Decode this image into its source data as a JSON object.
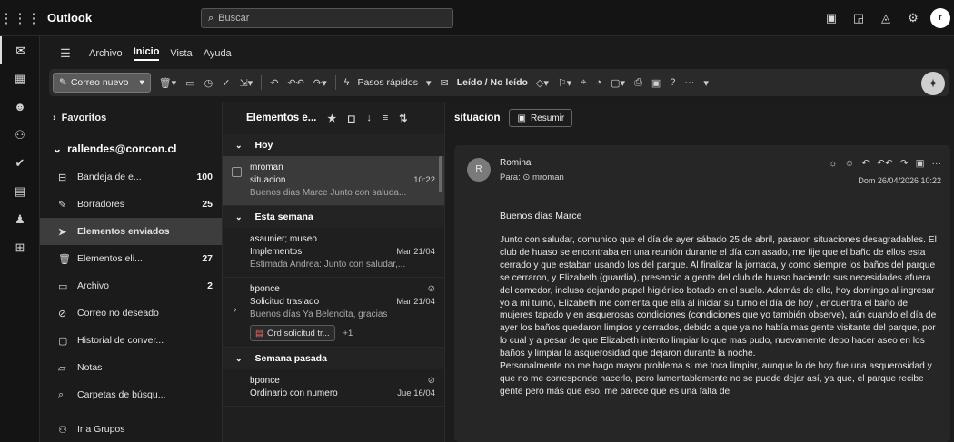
{
  "app": {
    "title": "Outlook",
    "search_placeholder": "Buscar"
  },
  "topbar_icons": [
    "present-icon",
    "feedback-icon",
    "bell-icon",
    "settings-icon"
  ],
  "rail_icons": [
    "mail-icon",
    "calendar-icon",
    "people-icon",
    "groups-icon",
    "todo-icon",
    "onedrive-icon",
    "org-icon",
    "apps-icon"
  ],
  "ribbon": {
    "tabs": [
      "Archivo",
      "Inicio",
      "Vista",
      "Ayuda"
    ],
    "active_tab": "Inicio",
    "new_mail": "Correo nuevo",
    "quick_steps": "Pasos rápidos",
    "read_unread": "Leído / No leído"
  },
  "folders": {
    "favorites": "Favoritos",
    "account": "rallendes@concon.cl",
    "items": [
      {
        "label": "Bandeja de e...",
        "count": "100",
        "icon": "inbox-icon"
      },
      {
        "label": "Borradores",
        "count": "25",
        "icon": "drafts-icon"
      },
      {
        "label": "Elementos enviados",
        "count": "",
        "icon": "sent-icon"
      },
      {
        "label": "Elementos eli...",
        "count": "27",
        "icon": "trash-icon"
      },
      {
        "label": "Archivo",
        "count": "2",
        "icon": "archive-icon"
      },
      {
        "label": "Correo no deseado",
        "count": "",
        "icon": "junk-icon"
      },
      {
        "label": "Historial de conver...",
        "count": "",
        "icon": "history-icon"
      },
      {
        "label": "Notas",
        "count": "",
        "icon": "notes-icon"
      },
      {
        "label": "Carpetas de búsqu...",
        "count": "",
        "icon": "search-folder-icon"
      }
    ],
    "groups": "Ir a Grupos"
  },
  "list": {
    "title": "Elementos e...",
    "groups": {
      "today": "Hoy",
      "this_week": "Esta semana",
      "last_week": "Semana pasada"
    },
    "messages": [
      {
        "from": "mroman",
        "subject": "situacion",
        "date": "10:22",
        "preview": "Buenos dias Marce Junto con saluda..."
      },
      {
        "from": "asaunier; museo",
        "subject": "Implementos",
        "date": "Mar 21/04",
        "preview": "Estimada Andrea: Junto con saludar,..."
      },
      {
        "from": "bponce",
        "subject": "Solicitud traslado",
        "date": "Mar 21/04",
        "preview": "Buenos días Ya Belencita, gracias",
        "attachment": "Ord solicitud tr...",
        "more": "+1"
      },
      {
        "from": "bponce",
        "subject": "Ordinario con numero",
        "date": "Jue 16/04",
        "preview": ""
      }
    ]
  },
  "reading": {
    "subject": "situacion",
    "summarize": "Resumir",
    "sender": "Romina",
    "avatar": "R",
    "to": "Para: ⊙ mroman",
    "datetime": "Dom 26/04/2026 10:22",
    "greeting": "Buenos días Marce",
    "body": [
      "Junto con saludar,  comunico que el día de ayer sábado 25 de abril, pasaron situaciones desagradables. El club de huaso se encontraba en una reunión durante el día con asado, me fije que el baño de ellos esta cerrado y que estaban usando los del parque. Al finalizar la jornada, y como siempre los baños del parque se cerraron, y  Elizabeth (guardia), presencio a gente del club de huaso haciendo sus necesidades afuera del comedor, incluso dejando papel higiénico botado en el suelo. Además de ello, hoy domingo al ingresar yo a mi turno, Elizabeth me comenta  que ella al iniciar su turno el día de hoy , encuentra el baño de mujeres tapado y en asquerosas condiciones (condiciones que yo también observe),  aún cuando el día de ayer los  baños quedaron limpios y cerrados, debido a que ya no había mas gente visitante del parque, por lo cual  y a pesar de que Elizabeth intento limpiar lo que mas pudo,  nuevamente debo  hacer aseo en los baños y limpiar la asquerosidad que dejaron durante la noche.",
      "Personalmente no me hago mayor problema si me toca limpiar, aunque lo de hoy fue una asquerosidad y que no me corresponde hacerlo, pero lamentablemente no se puede dejar así, ya que, el parque recibe gente  pero más que eso, me parece que es una falta de"
    ]
  }
}
